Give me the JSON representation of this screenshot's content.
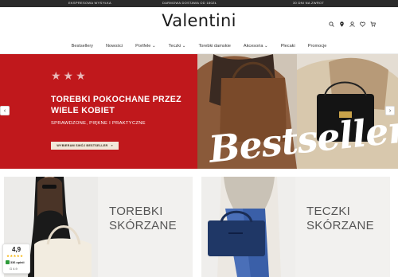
{
  "topbar": {
    "item1": "EKSPRESOWA WYSYŁKA",
    "item2": "DARMOWA DOSTAWA OD 180ZŁ",
    "item3": "30 DNI NA ZWROT"
  },
  "header": {
    "logo": "Valentini",
    "icons": [
      "search-icon",
      "location-pin-icon",
      "user-icon",
      "heart-icon",
      "cart-icon"
    ]
  },
  "nav": {
    "items": [
      {
        "label": "Bestsellery"
      },
      {
        "label": "Nowości"
      },
      {
        "label": "Portfele ⌄"
      },
      {
        "label": "Teczki ⌄"
      },
      {
        "label": "Torebki damskie"
      },
      {
        "label": "Akcesoria ⌄"
      },
      {
        "label": "Plecaki"
      },
      {
        "label": "Promocje"
      }
    ]
  },
  "hero": {
    "stars": "★★★",
    "title": "TOREBKI POKOCHANE PRZEZ WIELE KOBIET",
    "subtitle": "SPRAWDZONE, PIĘKNE I PRAKTYCZNE",
    "cta_label": "WYBIERAM SWÓJ BESTSELLER",
    "cta_arrow": "»",
    "script_text": "Bestseller",
    "prev_arrow": "‹",
    "next_arrow": "›",
    "accent_color": "#c0181c"
  },
  "categories": [
    {
      "line1": "TOREBKI",
      "line2": "SKÓRZANE"
    },
    {
      "line1": "TECZKI",
      "line2": "SKÓRZANE"
    }
  ],
  "rating_widget": {
    "score": "4,9",
    "stars": "★★★★★",
    "reviews": "336 opinii",
    "google": "G 4.9"
  }
}
